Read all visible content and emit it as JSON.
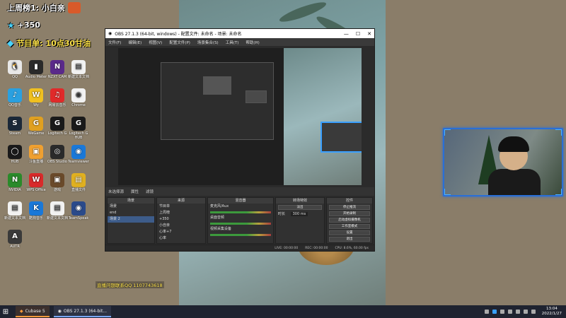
{
  "overlay": {
    "line1": "上周榜1: 小白亲",
    "line2": "+350",
    "line3": "节目单: 10点30甘油"
  },
  "desktop_icons": [
    {
      "label": "QQ",
      "color": "#e8e8e8",
      "glyph": "🐧"
    },
    {
      "label": "Audio Meter",
      "color": "#2a2a2a",
      "glyph": "▮"
    },
    {
      "label": "NZXT CAM",
      "color": "#5a2a8a",
      "glyph": "N"
    },
    {
      "label": "新建文本文档",
      "color": "#f2f2f2",
      "glyph": "▤"
    },
    {
      "label": "QQ音乐",
      "color": "#2aa0e0",
      "glyph": "♪"
    },
    {
      "label": "Wy",
      "color": "#f0c020",
      "glyph": "W"
    },
    {
      "label": "网易云音乐",
      "color": "#e02a2a",
      "glyph": "♫"
    },
    {
      "label": "Chrome",
      "color": "#f2f2f2",
      "glyph": "◉"
    },
    {
      "label": "Steam",
      "color": "#1b2838",
      "glyph": "S"
    },
    {
      "label": "WeGame",
      "color": "#e0a020",
      "glyph": "G"
    },
    {
      "label": "Logitech G",
      "color": "#1a1a1a",
      "glyph": "G"
    },
    {
      "label": "Logitech G HUB",
      "color": "#1a1a1a",
      "glyph": "G"
    },
    {
      "label": "HUB",
      "color": "#1a1a1a",
      "glyph": "◯"
    },
    {
      "label": "斗鱼直播",
      "color": "#f0a030",
      "glyph": "▣"
    },
    {
      "label": "OBS Studio",
      "color": "#2a2a2a",
      "glyph": "◎"
    },
    {
      "label": "Teamviewer",
      "color": "#1a78d8",
      "glyph": "◉"
    },
    {
      "label": "NVIDIA",
      "color": "#2a8a2a",
      "glyph": "N"
    },
    {
      "label": "WPS Office",
      "color": "#d82a2a",
      "glyph": "W"
    },
    {
      "label": "游戏",
      "color": "#6a4a2a",
      "glyph": "▣"
    },
    {
      "label": "直播文件",
      "color": "#e0b020",
      "glyph": "▤"
    },
    {
      "label": "新建文本文档",
      "color": "#f2f2f2",
      "glyph": "▤"
    },
    {
      "label": "酷狗音乐",
      "color": "#1a78d8",
      "glyph": "K"
    },
    {
      "label": "新建文本文档",
      "color": "#f2f2f2",
      "glyph": "▤"
    },
    {
      "label": "TeamSpeak",
      "color": "#2a4a8a",
      "glyph": "◉"
    },
    {
      "label": "AUTR",
      "color": "#3a3a3a",
      "glyph": "A"
    }
  ],
  "obs": {
    "title": "OBS 27.1.3 (64-bit, windows) - 配置文件: 未命名 - 场景: 未命名",
    "menu": [
      "文件(F)",
      "编辑(E)",
      "视图(V)",
      "配置文件(P)",
      "场景集合(S)",
      "工具(T)",
      "帮助(H)"
    ],
    "scene_bar": [
      "未选择源",
      "属性",
      "滤镜"
    ],
    "docks": {
      "scenes_title": "场景",
      "scenes": [
        "场景",
        "end",
        "场景 2"
      ],
      "sources_title": "来源",
      "sources": [
        "节目单",
        "上周榜",
        "+350",
        "小自亲",
        "心率+7",
        "心率"
      ],
      "mixer_title": "混音器",
      "mixer": [
        "麦克风/Aux",
        "桌面音频",
        "视频采集设备"
      ],
      "transitions_title": "转场特效",
      "transition": "淡出",
      "duration_label": "时长",
      "duration": "300 ms",
      "controls_title": "控件",
      "controls": [
        "停止推流",
        "开始录制",
        "启动虚拟摄像机",
        "工作室模式",
        "设置",
        "退出"
      ]
    },
    "status": [
      "LIVE: 00:00:00",
      "REC: 00:00:00",
      "CPU: 8.6%, 60.00 fps"
    ]
  },
  "ticker": "直播问题联系QQ 1107743618",
  "taskbar": {
    "start_icon": "windows-logo",
    "tasks": [
      "Cubase 5",
      "OBS 27.1.3 (64-bit..."
    ],
    "time": "13:04",
    "date": "2022/1/27"
  }
}
